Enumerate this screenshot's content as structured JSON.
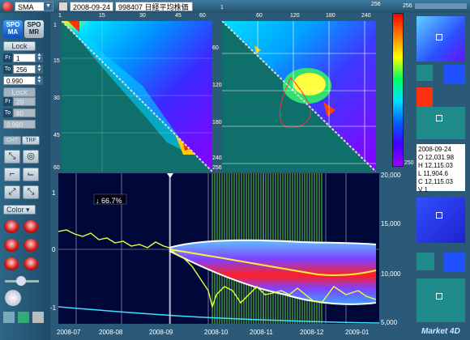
{
  "toolbar": {
    "indicator": "SMA",
    "date": "2008-09-24",
    "code": "998407",
    "name": "日経平均株価"
  },
  "left": {
    "logo1": "SPO MA",
    "logo2": "SPO MR",
    "lock1": "Lock",
    "fr1": "1",
    "to1": "256",
    "val1": "0.990",
    "lock2": "Lock",
    "fr2": "20",
    "to2": "60",
    "val2": "0.990",
    "tab1": "CHT",
    "tab2": "TRF",
    "color_label": "Color"
  },
  "hm1": {
    "top_ticks": [
      "1",
      "15",
      "30",
      "45",
      "60"
    ],
    "left_ticks": [
      "1",
      "15",
      "30",
      "45",
      "60"
    ]
  },
  "hm2": {
    "top_ticks": [
      "1",
      "60",
      "120",
      "180",
      "240",
      "256"
    ],
    "left_ticks": [
      "1",
      "60",
      "120",
      "180",
      "240",
      "256"
    ]
  },
  "colorbar": {
    "max": "256",
    "min": "250"
  },
  "info": {
    "date": "2008-09-24",
    "open": "O  12,031.98",
    "high": "H  12,115.03",
    "low": "L  11,904.6",
    "close": "C  12,115.03",
    "volume": "V  1"
  },
  "main": {
    "marker": "↓ 66.7%",
    "left_axis": [
      "1",
      "0",
      "-1"
    ],
    "right_axis": [
      "20,000",
      "15,000",
      "10,000",
      "5,000"
    ],
    "x_labels": [
      "2008-07",
      "2008-08",
      "2008-09",
      "2008-10",
      "2008-11",
      "2008-12",
      "2009-01"
    ]
  },
  "brand": "Market 4D"
}
